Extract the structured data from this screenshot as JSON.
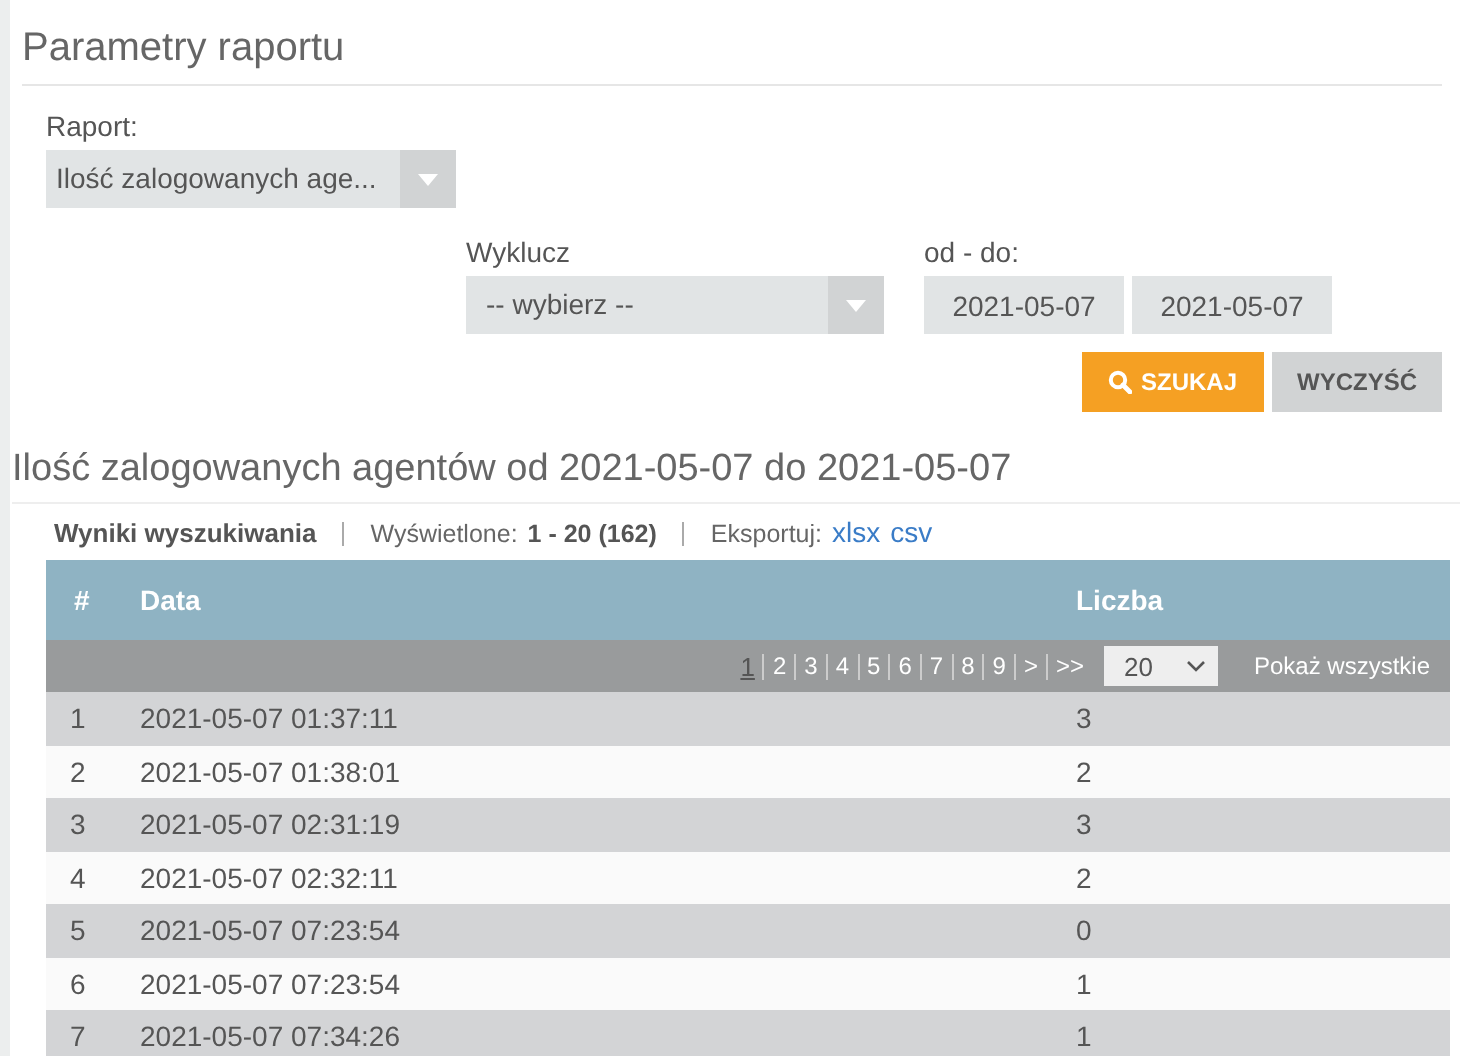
{
  "section_title": "Parametry raportu",
  "report_field": {
    "label": "Raport:",
    "value": "Ilość zalogowanych age..."
  },
  "exclude_field": {
    "label": "Wyklucz",
    "value": "-- wybierz --"
  },
  "date_range": {
    "label": "od - do:",
    "from": "2021-05-07",
    "to": "2021-05-07"
  },
  "buttons": {
    "search": "SZUKAJ",
    "clear": "WYCZYŚĆ"
  },
  "results_title": "Ilość zalogowanych agentów od 2021-05-07 do 2021-05-07",
  "results_bar": {
    "title": "Wyniki wyszukiwania",
    "shown_label": "Wyświetlone:",
    "shown_value": "1 - 20 (162)",
    "export_label": "Eksportuj:",
    "export_links": [
      "xlsx",
      "csv"
    ]
  },
  "table": {
    "columns": [
      "#",
      "Data",
      "Liczba"
    ],
    "pager": {
      "pages": [
        {
          "label": "1",
          "selected": true
        },
        {
          "label": "2",
          "selected": false
        },
        {
          "label": "3",
          "selected": false
        },
        {
          "label": "4",
          "selected": false
        },
        {
          "label": "5",
          "selected": false
        },
        {
          "label": "6",
          "selected": false
        },
        {
          "label": "7",
          "selected": false
        },
        {
          "label": "8",
          "selected": false
        },
        {
          "label": "9",
          "selected": false
        },
        {
          "label": ">",
          "selected": false
        },
        {
          "label": ">>",
          "selected": false
        }
      ],
      "page_size": "20",
      "show_all": "Pokaż wszystkie"
    },
    "rows": [
      {
        "cells": [
          "1",
          "2021-05-07 01:37:11",
          "3"
        ]
      },
      {
        "cells": [
          "2",
          "2021-05-07 01:38:01",
          "2"
        ]
      },
      {
        "cells": [
          "3",
          "2021-05-07 02:31:19",
          "3"
        ]
      },
      {
        "cells": [
          "4",
          "2021-05-07 02:32:11",
          "2"
        ]
      },
      {
        "cells": [
          "5",
          "2021-05-07 07:23:54",
          "0"
        ]
      },
      {
        "cells": [
          "6",
          "2021-05-07 07:23:54",
          "1"
        ]
      },
      {
        "cells": [
          "7",
          "2021-05-07 07:34:26",
          "1"
        ]
      }
    ]
  }
}
